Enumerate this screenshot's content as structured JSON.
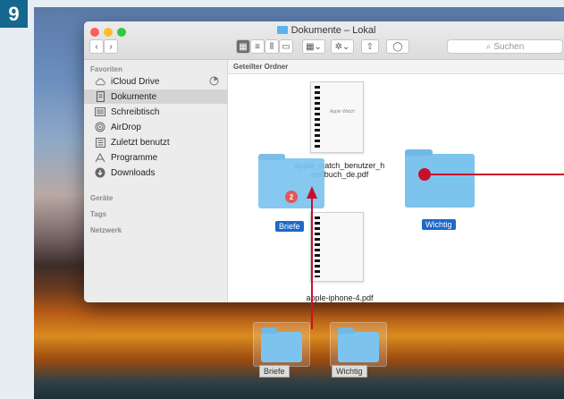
{
  "step": "9",
  "window": {
    "title": "Dokumente – Lokal",
    "search_placeholder": "Suchen"
  },
  "sidebar": {
    "sections": [
      "Favoriten",
      "Geräte",
      "Tags",
      "Netzwerk"
    ],
    "items": [
      {
        "label": "iCloud Drive",
        "icon": "cloud-icon"
      },
      {
        "label": "Dokumente",
        "icon": "documents-icon"
      },
      {
        "label": "Schreibtisch",
        "icon": "desktop-icon"
      },
      {
        "label": "AirDrop",
        "icon": "airdrop-icon"
      },
      {
        "label": "Zuletzt benutzt",
        "icon": "recent-icon"
      },
      {
        "label": "Programme",
        "icon": "applications-icon"
      },
      {
        "label": "Downloads",
        "icon": "downloads-icon"
      }
    ],
    "selected": "Dokumente"
  },
  "content": {
    "header": "Geteilter Ordner",
    "files": [
      {
        "name": "apple_watch_benutzer_handbuch_de.pdf",
        "name_line1": "apple_watch_benutzer_h",
        "name_line2": "andbuch_de.pdf",
        "kind": "pdf",
        "doc_title": "Apple Watch"
      },
      {
        "name": "Briefe",
        "kind": "folder",
        "badge": "2"
      },
      {
        "name": "Wichtig",
        "kind": "folder"
      },
      {
        "name": "apple-iphone-4.pdf",
        "kind": "pdf"
      }
    ]
  },
  "dock": [
    {
      "label": "Briefe"
    },
    {
      "label": "Wichtig"
    }
  ],
  "colors": {
    "accent": "#1e68c9",
    "arrow": "#c8102e",
    "folder": "#7cc4ee",
    "step_badge": "#14678f"
  }
}
